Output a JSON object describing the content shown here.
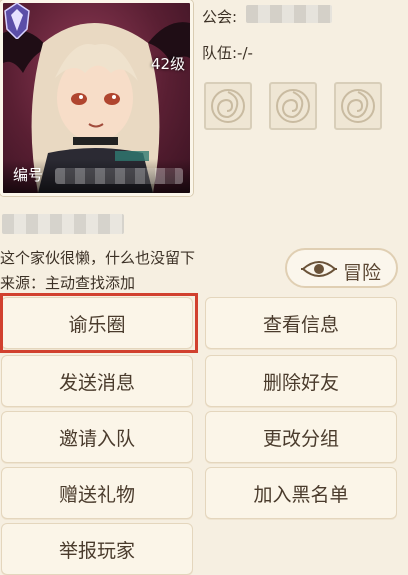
{
  "profile": {
    "level": "42级",
    "id_label": "编号",
    "guild_label": "公会:",
    "team_label": "队伍:-/-",
    "bio": "这个家伙很懒，什么也没留下",
    "source": "来源：主动查找添加"
  },
  "adventure_button": {
    "label": "冒险"
  },
  "actions": {
    "moments": "谕乐圈",
    "view_info": "查看信息",
    "send_message": "发送消息",
    "delete_friend": "删除好友",
    "invite_team": "邀请入队",
    "change_group": "更改分组",
    "send_gift": "赠送礼物",
    "blacklist": "加入黑名单",
    "report": "举报玩家"
  },
  "colors": {
    "background": "#f6efe1",
    "button_bg": "#fbf5e8",
    "highlight": "#d1402e"
  }
}
